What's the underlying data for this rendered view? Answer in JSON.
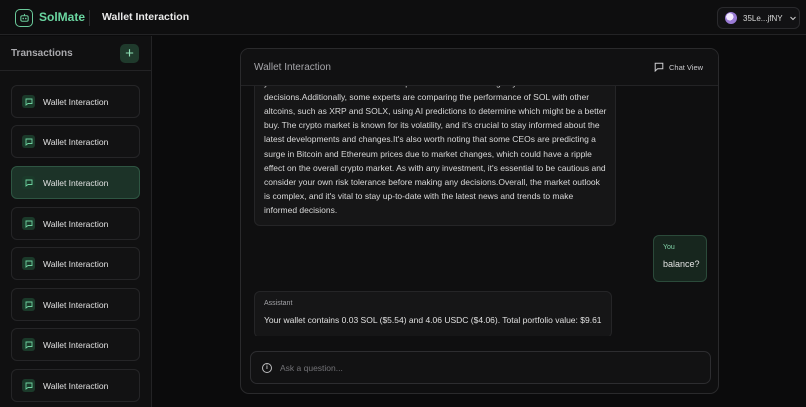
{
  "header": {
    "brand": "SolMate",
    "title": "Wallet Interaction",
    "wallet_address": "35Le...jfNY"
  },
  "sidebar": {
    "title": "Transactions",
    "add_label": "+",
    "items": [
      {
        "label": "Wallet Interaction",
        "active": false
      },
      {
        "label": "Wallet Interaction",
        "active": false
      },
      {
        "label": "Wallet Interaction",
        "active": true
      },
      {
        "label": "Wallet Interaction",
        "active": false
      },
      {
        "label": "Wallet Interaction",
        "active": false
      },
      {
        "label": "Wallet Interaction",
        "active": false
      },
      {
        "label": "Wallet Interaction",
        "active": false
      },
      {
        "label": "Wallet Interaction",
        "active": false
      }
    ]
  },
  "chat": {
    "title": "Wallet Interaction",
    "view_label": "Chat View",
    "long_message": "your own research and consider multiple factors before making any investment decisions.Additionally, some experts are comparing the performance of SOL with other altcoins, such as XRP and SOLX, using AI predictions to determine which might be a better buy. The crypto market is known for its volatility, and it's crucial to stay informed about the latest developments and changes.It's also worth noting that some CEOs are predicting a surge in Bitcoin and Ethereum prices due to market changes, which could have a ripple effect on the overall crypto market. As with any investment, it's essential to be cautious and consider your own risk tolerance before making any decisions.Overall, the market outlook is complex, and it's vital to stay up-to-date with the latest news and trends to make informed decisions.",
    "user_role": "You",
    "user_message": "balance?",
    "assistant_role": "Assistant",
    "assistant_message": "Your wallet contains 0.03 SOL ($5.54) and 4.06 USDC ($4.06). Total portfolio value: $9.61",
    "input_placeholder": "Ask a question...",
    "input_value": ""
  },
  "colors": {
    "accent": "#6ad6a1",
    "active_item_bg": "#1c3328",
    "background": "#0b0b0c"
  },
  "icons": {
    "logo": "robot-icon",
    "wallet": "wallet-avatar-icon",
    "chevron": "chevron-down-icon",
    "add": "plus-icon",
    "message": "message-square-icon",
    "info": "info-icon"
  }
}
